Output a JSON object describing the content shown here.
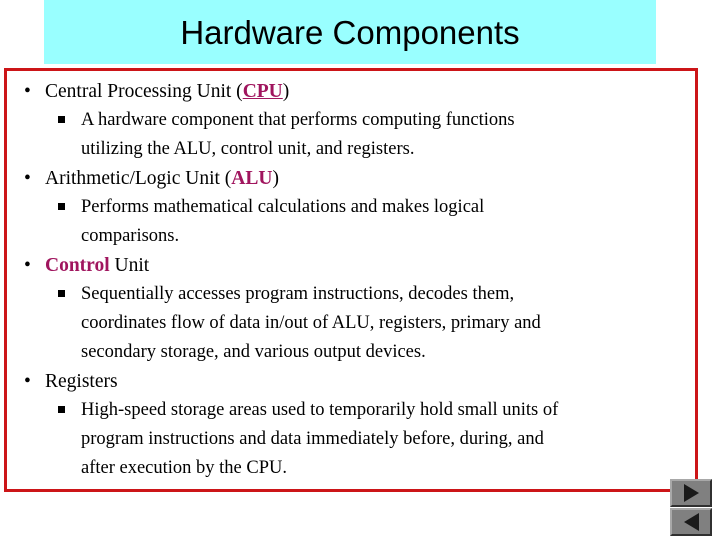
{
  "slide": {
    "title": "Hardware Components",
    "title_background_color": "#99FFFF",
    "content_border_color": "#CC1518",
    "accent_color": "#A0155E"
  },
  "bullets": [
    {
      "level1": {
        "marker": "bullet-dot",
        "pre": "Central Processing Unit (",
        "accent": "CPU",
        "accent_style": "bold-underline",
        "post": ")"
      },
      "level2": [
        {
          "marker": "bullet-square",
          "lines": [
            "A hardware component that performs computing functions",
            "utilizing the ALU, control unit, and registers."
          ]
        }
      ]
    },
    {
      "level1": {
        "marker": "bullet-dot",
        "pre": "Arithmetic/Logic Unit (",
        "accent": "ALU",
        "accent_style": "bold",
        "post": ")"
      },
      "level2": [
        {
          "marker": "bullet-square",
          "lines": [
            "Performs mathematical calculations and makes logical",
            "comparisons."
          ]
        }
      ]
    },
    {
      "level1": {
        "marker": "bullet-dot",
        "pre": "",
        "accent": "Control",
        "accent_style": "bold",
        "post": " Unit"
      },
      "level2": [
        {
          "marker": "bullet-square",
          "lines": [
            "Sequentially accesses program instructions, decodes them,",
            "coordinates flow of data in/out of ALU, registers, primary and",
            "secondary storage, and various output devices."
          ]
        }
      ]
    },
    {
      "level1": {
        "marker": "bullet-dot",
        "pre": "Registers",
        "accent": "",
        "accent_style": "none",
        "post": ""
      },
      "level2": [
        {
          "marker": "bullet-square",
          "lines": [
            "High-speed storage areas used to temporarily hold small units of",
            "program instructions and data immediately before, during, and",
            "after execution by the CPU."
          ]
        }
      ]
    }
  ],
  "navigation": {
    "next_label": "next-slide",
    "prev_label": "previous-slide",
    "button_color": "#808080"
  },
  "glyphs": {
    "dot": "•"
  }
}
